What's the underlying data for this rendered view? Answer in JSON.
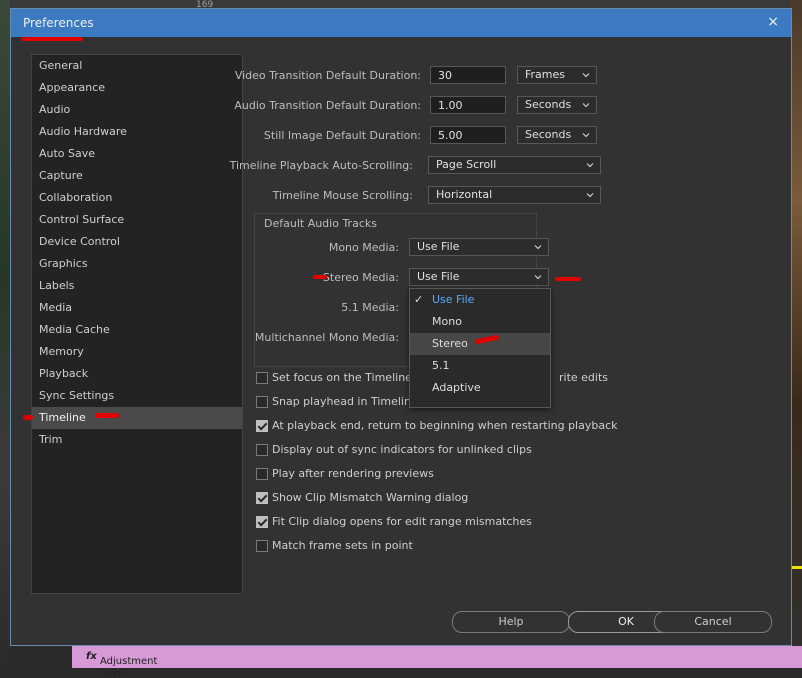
{
  "background": {
    "ruler_number": "169",
    "layer_label": "Adjustment Layer",
    "fx_icon": "fx"
  },
  "window": {
    "title": "Preferences",
    "close_glyph": "×"
  },
  "sidebar": {
    "items": [
      "General",
      "Appearance",
      "Audio",
      "Audio Hardware",
      "Auto Save",
      "Capture",
      "Collaboration",
      "Control Surface",
      "Device Control",
      "Graphics",
      "Labels",
      "Media",
      "Media Cache",
      "Memory",
      "Playback",
      "Sync Settings",
      "Timeline",
      "Trim"
    ],
    "selected": "Timeline"
  },
  "settings": {
    "video_transition": {
      "label": "Video Transition Default Duration:",
      "value": "30",
      "unit": "Frames"
    },
    "audio_transition": {
      "label": "Audio Transition Default Duration:",
      "value": "1.00",
      "unit": "Seconds"
    },
    "still_image": {
      "label": "Still Image Default Duration:",
      "value": "5.00",
      "unit": "Seconds"
    },
    "auto_scrolling": {
      "label": "Timeline Playback Auto-Scrolling:",
      "value": "Page Scroll"
    },
    "mouse_scrolling": {
      "label": "Timeline Mouse Scrolling:",
      "value": "Horizontal"
    }
  },
  "audio_tracks": {
    "group_title": "Default Audio Tracks",
    "mono": {
      "label": "Mono Media:",
      "value": "Use File"
    },
    "stereo": {
      "label": "Stereo Media:",
      "value": "Use File"
    },
    "five_one": {
      "label": "5.1 Media:"
    },
    "multichannel": {
      "label": "Multichannel Mono Media:"
    }
  },
  "dropdown": {
    "options": [
      "Use File",
      "Mono",
      "Stereo",
      "5.1",
      "Adaptive"
    ],
    "checked": "Use File",
    "hovered": "Stereo",
    "check_glyph": "✓"
  },
  "checkboxes": [
    {
      "label": "Set focus on the Timeline w",
      "tail": "rite edits",
      "checked": false
    },
    {
      "label": "Snap playhead in Timeline w",
      "tail": "",
      "checked": false
    },
    {
      "label": "At playback end, return to beginning when restarting playback",
      "checked": true
    },
    {
      "label": "Display out of sync indicators for unlinked clips",
      "checked": false
    },
    {
      "label": "Play after rendering previews",
      "checked": false
    },
    {
      "label": "Show Clip Mismatch Warning dialog",
      "checked": true
    },
    {
      "label": "Fit Clip dialog opens for edit range mismatches",
      "checked": true
    },
    {
      "label": "Match frame sets in point",
      "checked": false
    }
  ],
  "buttons": {
    "help": "Help",
    "ok": "OK",
    "cancel": "Cancel"
  },
  "colors": {
    "titlebar": "#3c7bc2",
    "checked_option": "#5aa9ff",
    "annotation": "#e00000"
  }
}
